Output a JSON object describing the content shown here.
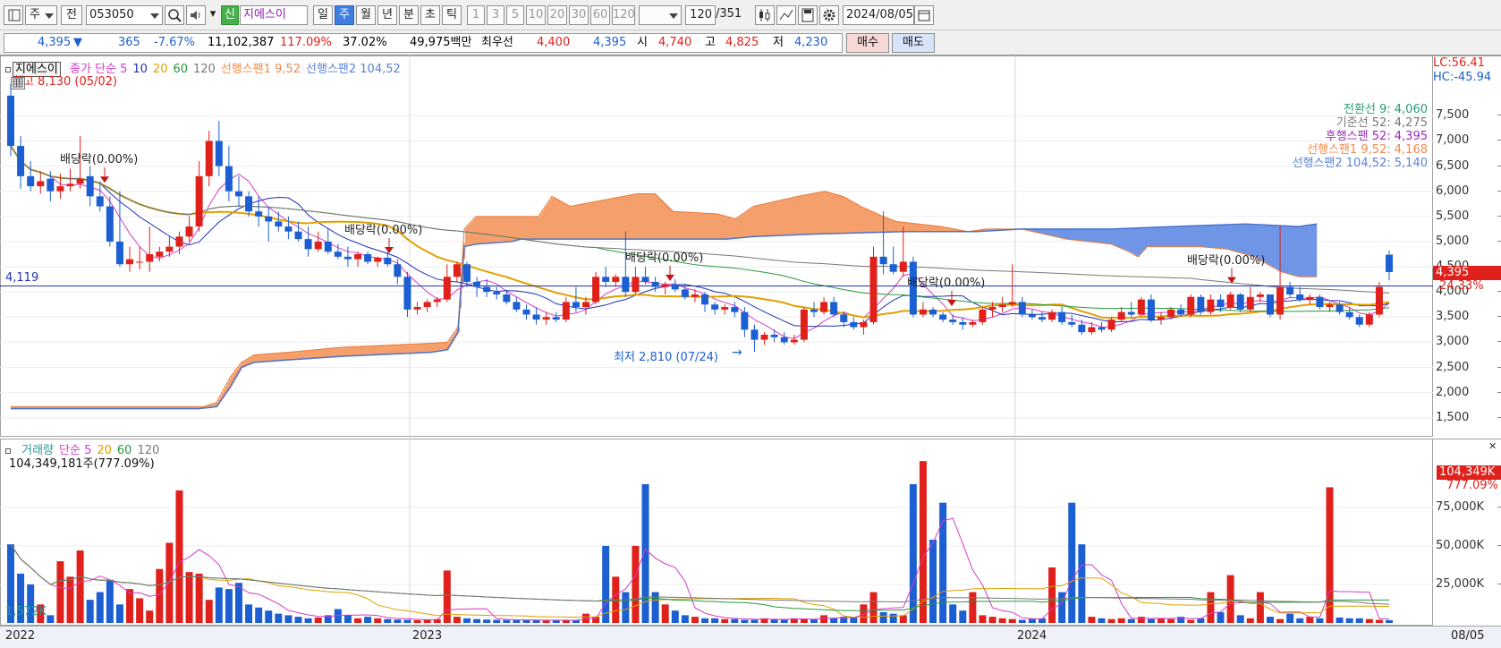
{
  "toolbar": {
    "period_selector": "주",
    "prev_label": "전",
    "stock_code": "053050",
    "credit_badge": "신",
    "stock_name": "지에스이",
    "period_tabs": [
      {
        "label": "일",
        "selected": false
      },
      {
        "label": "주",
        "selected": true
      },
      {
        "label": "월",
        "selected": false
      },
      {
        "label": "년",
        "selected": false
      },
      {
        "label": "분",
        "selected": false
      },
      {
        "label": "초",
        "selected": false
      },
      {
        "label": "틱",
        "selected": false
      }
    ],
    "interval_buttons": [
      "1",
      "3",
      "5",
      "10",
      "20",
      "30",
      "60",
      "120"
    ],
    "bar_count": "120",
    "bar_total": "/351",
    "date": "2024/08/05",
    "icons": [
      "layout-icon",
      "search-icon",
      "speaker-icon",
      "candle-icon",
      "line-tool-icon",
      "save-icon",
      "settings-icon",
      "calendar-icon"
    ]
  },
  "quote": {
    "price": "4,395",
    "direction": "▼",
    "change": "365",
    "change_rate": "-7.67%",
    "volume": "11,102,387",
    "volume_ratio": "117.09%",
    "turnover": "37.02%",
    "amount": "49,975백만",
    "best_label": "최우선",
    "best_ask": "4,400",
    "best_bid": "4,395",
    "open_label": "시",
    "open": "4,740",
    "high_label": "고",
    "high": "4,825",
    "low_label": "저",
    "low": "4,230",
    "buy_label": "매수",
    "sell_label": "매도"
  },
  "price_legend": {
    "name": "지에스이",
    "items": [
      {
        "text": "종가 단순 5",
        "color": "#d63cc9"
      },
      {
        "text": "10",
        "color": "#1f33b0"
      },
      {
        "text": "20",
        "color": "#e0a000"
      },
      {
        "text": "60",
        "color": "#279a3a"
      },
      {
        "text": "120",
        "color": "#777777"
      },
      {
        "text": "선행스팬1 9,52",
        "color": "#f28a4c"
      },
      {
        "text": "선행스팬2 104,52",
        "color": "#5a82d8"
      }
    ],
    "max_note": "최고 8,130 (05/02)",
    "min_note": "최저 2,810 (07/24)",
    "level_label": "4,119",
    "lc": "LC:56.41",
    "hc": "HC:-45.94"
  },
  "ichimoku_values": [
    {
      "text": "전환선 9: 4,060",
      "color": "#279a7a"
    },
    {
      "text": "기준선 52: 4,275",
      "color": "#777777"
    },
    {
      "text": "후행스팬 52: 4,395",
      "color": "#9b2ab8"
    },
    {
      "text": "선행스팬1 9,52: 4,168",
      "color": "#f28a4c"
    },
    {
      "text": "선행스팬2 104,52: 5,140",
      "color": "#5a82d8"
    }
  ],
  "dividend_label": "배당락(0.00%)",
  "price_axis": [
    "7,500",
    "7,000",
    "6,500",
    "6,000",
    "5,500",
    "5,000",
    "4,500",
    "4,000",
    "3,500",
    "3,000",
    "2,500",
    "2,000",
    "1,500"
  ],
  "price_tags": {
    "current": "4,395",
    "pct": "24.33%"
  },
  "volume_legend": {
    "items": [
      {
        "text": "거래량",
        "color": "#279a9a"
      },
      {
        "text": "단순 5",
        "color": "#d63cc9"
      },
      {
        "text": "20",
        "color": "#e0a000"
      },
      {
        "text": "60",
        "color": "#279a3a"
      },
      {
        "text": "120",
        "color": "#777777"
      }
    ],
    "max_note": "104,349,181주(777.09%)",
    "min_note": "1,572K",
    "current_tag": "104,349K",
    "pct_tag": "777.09%"
  },
  "volume_axis": [
    "75,000K",
    "50,000K",
    "25,000K"
  ],
  "x_axis": [
    "2022",
    "2023",
    "2024",
    "08/05"
  ],
  "colors": {
    "up": "#e0201a",
    "down": "#1b5fd2",
    "cloud_up": "#f5a06c",
    "cloud_down": "#6f96e6"
  },
  "chart_data": {
    "type": "candlestick",
    "period": "weekly",
    "ylim": [
      1300,
      8200
    ],
    "candles": [
      [
        7900,
        8130,
        6700,
        6900
      ],
      [
        6900,
        7100,
        6050,
        6300
      ],
      [
        6300,
        6600,
        6000,
        6100
      ],
      [
        6100,
        6400,
        5950,
        6200
      ],
      [
        6250,
        6400,
        5800,
        6000
      ],
      [
        6000,
        6350,
        5850,
        6100
      ],
      [
        6100,
        6450,
        6000,
        6150
      ],
      [
        6150,
        7100,
        6050,
        6250
      ],
      [
        6300,
        6500,
        5700,
        5900
      ],
      [
        5900,
        6200,
        5600,
        5700
      ],
      [
        5700,
        5900,
        4900,
        5000
      ],
      [
        5000,
        6000,
        4500,
        4550
      ],
      [
        4550,
        4900,
        4400,
        4650
      ],
      [
        4600,
        4900,
        4450,
        4600
      ],
      [
        4600,
        5300,
        4400,
        4750
      ],
      [
        4700,
        4900,
        4600,
        4800
      ],
      [
        4800,
        5100,
        4700,
        4900
      ],
      [
        4900,
        5200,
        4750,
        5100
      ],
      [
        5100,
        5500,
        5000,
        5300
      ],
      [
        5300,
        6600,
        5200,
        6300
      ],
      [
        6300,
        7200,
        6100,
        7000
      ],
      [
        7000,
        7400,
        6300,
        6500
      ],
      [
        6500,
        6900,
        5800,
        6000
      ],
      [
        6000,
        6300,
        5700,
        5900
      ],
      [
        5900,
        6000,
        5500,
        5600
      ],
      [
        5600,
        5900,
        5300,
        5500
      ],
      [
        5500,
        5700,
        5000,
        5400
      ],
      [
        5400,
        5600,
        5200,
        5300
      ],
      [
        5300,
        5500,
        5050,
        5200
      ],
      [
        5200,
        5400,
        5000,
        5050
      ],
      [
        5050,
        5300,
        4700,
        4850
      ],
      [
        4850,
        5200,
        4800,
        5000
      ],
      [
        5000,
        5250,
        4750,
        4800
      ],
      [
        4800,
        4950,
        4650,
        4700
      ],
      [
        4700,
        4900,
        4500,
        4650
      ],
      [
        4650,
        4800,
        4500,
        4750
      ],
      [
        4750,
        4800,
        4550,
        4600
      ],
      [
        4600,
        4700,
        4500,
        4680
      ],
      [
        4680,
        4800,
        4500,
        4550
      ],
      [
        4550,
        4650,
        4150,
        4300
      ],
      [
        4300,
        4400,
        3500,
        3650
      ],
      [
        3650,
        3800,
        3550,
        3700
      ],
      [
        3700,
        3850,
        3600,
        3800
      ],
      [
        3800,
        3900,
        3700,
        3850
      ],
      [
        3850,
        4550,
        3800,
        4300
      ],
      [
        4300,
        4600,
        4200,
        4550
      ],
      [
        4550,
        4600,
        4100,
        4200
      ],
      [
        4200,
        4300,
        3900,
        4100
      ],
      [
        4100,
        4250,
        3900,
        4000
      ],
      [
        4000,
        4100,
        3850,
        3950
      ],
      [
        3950,
        4050,
        3750,
        3800
      ],
      [
        3800,
        3900,
        3600,
        3650
      ],
      [
        3650,
        3750,
        3450,
        3550
      ],
      [
        3550,
        3700,
        3350,
        3450
      ],
      [
        3450,
        3600,
        3350,
        3500
      ],
      [
        3500,
        3600,
        3400,
        3450
      ],
      [
        3450,
        3900,
        3400,
        3800
      ],
      [
        3800,
        4100,
        3600,
        3700
      ],
      [
        3700,
        3900,
        3550,
        3800
      ],
      [
        3800,
        4400,
        3750,
        4300
      ],
      [
        4300,
        4500,
        4100,
        4200
      ],
      [
        4200,
        4350,
        4100,
        4300
      ],
      [
        4300,
        5200,
        3900,
        4000
      ],
      [
        4000,
        4500,
        3950,
        4300
      ],
      [
        4300,
        4500,
        4150,
        4200
      ],
      [
        4200,
        4300,
        4000,
        4100
      ],
      [
        4100,
        4200,
        3950,
        4150
      ],
      [
        4150,
        4250,
        4000,
        4050
      ],
      [
        4050,
        4150,
        3850,
        3900
      ],
      [
        3900,
        4050,
        3800,
        3950
      ],
      [
        3950,
        4000,
        3600,
        3750
      ],
      [
        3750,
        3800,
        3550,
        3650
      ],
      [
        3650,
        3750,
        3550,
        3700
      ],
      [
        3700,
        3800,
        3500,
        3600
      ],
      [
        3600,
        3700,
        3100,
        3250
      ],
      [
        3250,
        3350,
        2810,
        3050
      ],
      [
        3050,
        3200,
        2950,
        3150
      ],
      [
        3150,
        3250,
        3000,
        3100
      ],
      [
        3100,
        3200,
        2950,
        3000
      ],
      [
        3000,
        3150,
        2950,
        3050
      ],
      [
        3050,
        3700,
        3000,
        3650
      ],
      [
        3650,
        3800,
        3500,
        3600
      ],
      [
        3600,
        3900,
        3550,
        3800
      ],
      [
        3800,
        3900,
        3500,
        3550
      ],
      [
        3550,
        3600,
        3300,
        3400
      ],
      [
        3400,
        3500,
        3250,
        3300
      ],
      [
        3300,
        3450,
        3150,
        3400
      ],
      [
        3400,
        4900,
        3350,
        4700
      ],
      [
        4700,
        5600,
        4350,
        4550
      ],
      [
        4550,
        4900,
        4350,
        4400
      ],
      [
        4400,
        5300,
        4300,
        4600
      ],
      [
        4600,
        4700,
        3500,
        3550
      ],
      [
        3550,
        3800,
        3500,
        3650
      ],
      [
        3650,
        3700,
        3500,
        3550
      ],
      [
        3550,
        3600,
        3400,
        3450
      ],
      [
        3450,
        3550,
        3350,
        3400
      ],
      [
        3400,
        3500,
        3250,
        3350
      ],
      [
        3350,
        3450,
        3300,
        3400
      ],
      [
        3400,
        3700,
        3350,
        3650
      ],
      [
        3650,
        3800,
        3500,
        3700
      ],
      [
        3700,
        3900,
        3600,
        3750
      ],
      [
        3750,
        4550,
        3700,
        3800
      ],
      [
        3800,
        3900,
        3500,
        3550
      ],
      [
        3550,
        3650,
        3450,
        3500
      ],
      [
        3500,
        3600,
        3400,
        3450
      ],
      [
        3450,
        3650,
        3400,
        3600
      ],
      [
        3600,
        3700,
        3350,
        3400
      ],
      [
        3400,
        3550,
        3300,
        3350
      ],
      [
        3350,
        3450,
        3150,
        3200
      ],
      [
        3200,
        3400,
        3150,
        3300
      ],
      [
        3300,
        3400,
        3200,
        3250
      ],
      [
        3250,
        3500,
        3200,
        3450
      ],
      [
        3450,
        3700,
        3400,
        3600
      ],
      [
        3600,
        3800,
        3500,
        3550
      ],
      [
        3550,
        3900,
        3550,
        3850
      ],
      [
        3850,
        3950,
        3400,
        3450
      ],
      [
        3450,
        3600,
        3350,
        3500
      ],
      [
        3500,
        3700,
        3450,
        3650
      ],
      [
        3650,
        3750,
        3500,
        3550
      ],
      [
        3550,
        3950,
        3500,
        3900
      ],
      [
        3900,
        3950,
        3550,
        3600
      ],
      [
        3600,
        3950,
        3550,
        3850
      ],
      [
        3850,
        3950,
        3600,
        3700
      ],
      [
        3700,
        4000,
        3650,
        3950
      ],
      [
        3950,
        3980,
        3600,
        3650
      ],
      [
        3650,
        4100,
        3600,
        3900
      ],
      [
        3900,
        4000,
        3800,
        3950
      ],
      [
        3950,
        3950,
        3500,
        3550
      ],
      [
        3550,
        5300,
        3450,
        4100
      ],
      [
        4100,
        4200,
        3900,
        3950
      ],
      [
        3950,
        4100,
        3800,
        3850
      ],
      [
        3850,
        3950,
        3750,
        3900
      ],
      [
        3900,
        3950,
        3650,
        3700
      ],
      [
        3700,
        3800,
        3600,
        3750
      ],
      [
        3750,
        3800,
        3550,
        3600
      ],
      [
        3600,
        3700,
        3450,
        3500
      ],
      [
        3500,
        3550,
        3300,
        3350
      ],
      [
        3350,
        3600,
        3300,
        3550
      ],
      [
        3550,
        4200,
        3500,
        4100
      ],
      [
        4740,
        4825,
        4230,
        4395
      ]
    ],
    "volume_k": [
      51000,
      32000,
      25000,
      12000,
      5000,
      40000,
      30000,
      47000,
      15000,
      20000,
      28000,
      12000,
      22000,
      16000,
      8000,
      35000,
      52000,
      86000,
      33000,
      32000,
      15000,
      23000,
      22000,
      26000,
      12000,
      10000,
      8000,
      6000,
      5000,
      4000,
      3000,
      3500,
      5000,
      9000,
      5000,
      3000,
      4000,
      3000,
      2500,
      2200,
      2000,
      1800,
      2000,
      2500,
      34000,
      4000,
      3000,
      2500,
      2200,
      2000,
      1900,
      1800,
      2000,
      1800,
      1600,
      1700,
      1800,
      1700,
      6000,
      4000,
      50000,
      30000,
      20000,
      50000,
      90000,
      20000,
      12000,
      8000,
      5000,
      4000,
      3000,
      3000,
      2500,
      2500,
      2000,
      2000,
      3000,
      2500,
      2000,
      3000,
      2500,
      2200,
      5000,
      3000,
      4000,
      3500,
      12000,
      20000,
      7000,
      6000,
      5000,
      90000,
      105000,
      54000,
      78000,
      12000,
      8000,
      20000,
      5000,
      4000,
      3000,
      2500,
      2000,
      2500,
      3000,
      36000,
      20000,
      78000,
      51000,
      4000,
      3000,
      2500,
      3000,
      2500,
      4000,
      2500,
      3000,
      2500,
      4000,
      2000,
      3000,
      20000,
      7000,
      31000,
      5000,
      3000,
      20000,
      4000,
      2500,
      6000,
      3000,
      4000,
      3000,
      88000,
      3500,
      3000,
      3000,
      2500,
      2000,
      1800,
      2000,
      2500,
      10000,
      104349
    ],
    "ichimoku": {
      "span1": [
        [
          0,
          1720
        ],
        [
          215,
          1720
        ],
        [
          230,
          1800
        ],
        [
          245,
          2300
        ],
        [
          258,
          2600
        ],
        [
          272,
          2750
        ],
        [
          310,
          2800
        ],
        [
          370,
          2900
        ],
        [
          470,
          2980
        ],
        [
          488,
          3000
        ],
        [
          500,
          3300
        ],
        [
          507,
          5250
        ],
        [
          520,
          5500
        ],
        [
          590,
          5500
        ],
        [
          605,
          5900
        ],
        [
          625,
          5700
        ],
        [
          700,
          5950
        ],
        [
          720,
          5950
        ],
        [
          740,
          5600
        ],
        [
          790,
          5550
        ],
        [
          810,
          5450
        ],
        [
          830,
          5700
        ],
        [
          880,
          5900
        ],
        [
          910,
          6000
        ],
        [
          930,
          5900
        ],
        [
          950,
          5700
        ],
        [
          975,
          5500
        ],
        [
          990,
          5400
        ],
        [
          1040,
          5300
        ],
        [
          1070,
          5200
        ],
        [
          1090,
          5250
        ],
        [
          1130,
          5250
        ],
        [
          1180,
          5050
        ],
        [
          1230,
          4950
        ],
        [
          1250,
          4800
        ],
        [
          1260,
          4700
        ],
        [
          1270,
          4900
        ],
        [
          1300,
          4900
        ],
        [
          1330,
          4900
        ],
        [
          1360,
          4850
        ],
        [
          1390,
          4700
        ],
        [
          1420,
          4400
        ],
        [
          1440,
          4300
        ],
        [
          1460,
          4300
        ]
      ],
      "span2": [
        [
          0,
          1680
        ],
        [
          210,
          1680
        ],
        [
          230,
          1720
        ],
        [
          245,
          2100
        ],
        [
          258,
          2500
        ],
        [
          272,
          2600
        ],
        [
          310,
          2650
        ],
        [
          370,
          2720
        ],
        [
          470,
          2800
        ],
        [
          488,
          2850
        ],
        [
          500,
          3200
        ],
        [
          507,
          4900
        ],
        [
          520,
          4950
        ],
        [
          560,
          5000
        ],
        [
          570,
          5050
        ],
        [
          600,
          5050
        ],
        [
          720,
          5050
        ],
        [
          740,
          5050
        ],
        [
          800,
          5050
        ],
        [
          830,
          5100
        ],
        [
          900,
          5150
        ],
        [
          1000,
          5200
        ],
        [
          1080,
          5200
        ],
        [
          1130,
          5250
        ],
        [
          1180,
          5250
        ],
        [
          1230,
          5250
        ],
        [
          1300,
          5300
        ],
        [
          1380,
          5350
        ],
        [
          1440,
          5300
        ],
        [
          1460,
          5350
        ]
      ]
    },
    "dividends": [
      [
        105,
        6400,
        "배당락(0.00%)"
      ],
      [
        423,
        5000,
        "배당락(0.00%)"
      ],
      [
        737,
        4450,
        "배당락(0.00%)"
      ],
      [
        1052,
        3950,
        "배당락(0.00%)"
      ],
      [
        1365,
        4400,
        "배당락(0.00%)"
      ]
    ],
    "ma_colors": [
      "#d63cc9",
      "#1f33b0",
      "#e0a000",
      "#279a3a",
      "#777777"
    ]
  }
}
